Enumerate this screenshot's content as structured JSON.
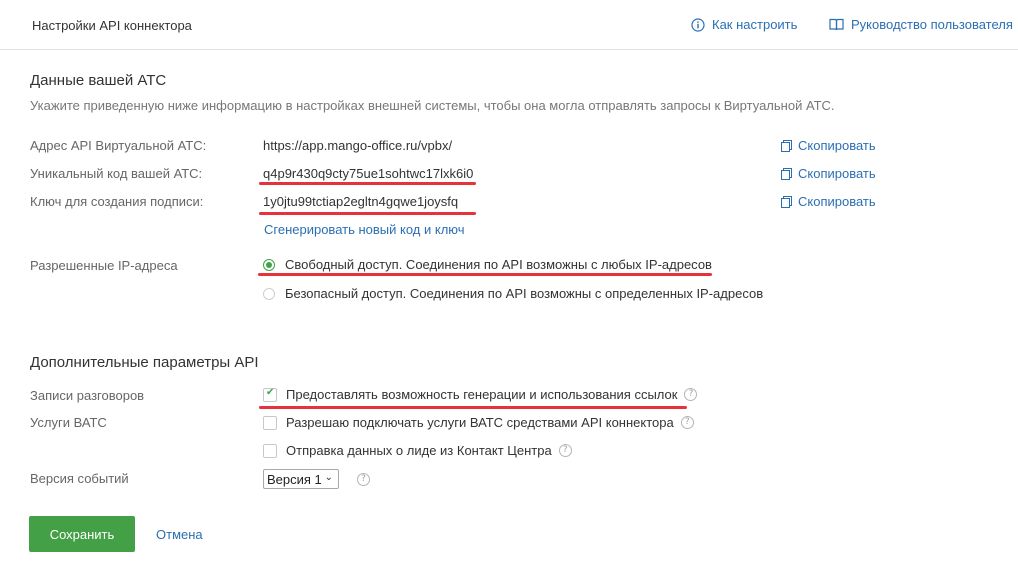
{
  "header": {
    "title": "Настройки API коннектора",
    "howto_label": "Как настроить",
    "guide_label": "Руководство пользователя"
  },
  "pbx": {
    "section_title": "Данные вашей АТС",
    "hint": "Укажите приведенную ниже информацию в настройках внешней системы, чтобы она могла отправлять запросы к Виртуальной АТС.",
    "rows": [
      {
        "label": "Адрес API Виртуальной АТС:",
        "value": "https://app.mango-office.ru/vpbx/",
        "copy": "Скопировать"
      },
      {
        "label": "Уникальный код вашей АТС:",
        "value": "q4p9r430q9cty75ue1sohtwc17lxk6i0",
        "copy": "Скопировать"
      },
      {
        "label": "Ключ для создания подписи:",
        "value": "1y0jtu99tctiap2egltn4gqwe1joysfq",
        "copy": "Скопировать"
      }
    ],
    "generate_link": "Сгенерировать новый код и ключ",
    "ip_label": "Разрешенные IP-адреса",
    "ip_options": [
      {
        "label": "Свободный доступ. Соединения по API возможны с любых IP-адресов",
        "selected": true
      },
      {
        "label": "Безопасный доступ. Соединения по API возможны с определенных IP-адресов",
        "selected": false
      }
    ]
  },
  "extra": {
    "section_title": "Дополнительные параметры API",
    "recordings_label": "Записи разговоров",
    "recordings_option": {
      "label": "Предоставлять возможность генерации и использования ссылок",
      "checked": true
    },
    "vats_label": "Услуги ВАТС",
    "vats_options": [
      {
        "label": "Разрешаю подключать услуги ВАТС средствами API коннектора",
        "checked": false
      },
      {
        "label": "Отправка данных о лиде из Контакт Центра",
        "checked": false
      }
    ],
    "events_label": "Версия событий",
    "events_value": "Версия 1"
  },
  "actions": {
    "save_label": "Сохранить",
    "cancel_label": "Отмена"
  },
  "colors": {
    "accent": "#2b6fb3",
    "primary_button": "#43a047",
    "annotation": "#e8323b"
  }
}
